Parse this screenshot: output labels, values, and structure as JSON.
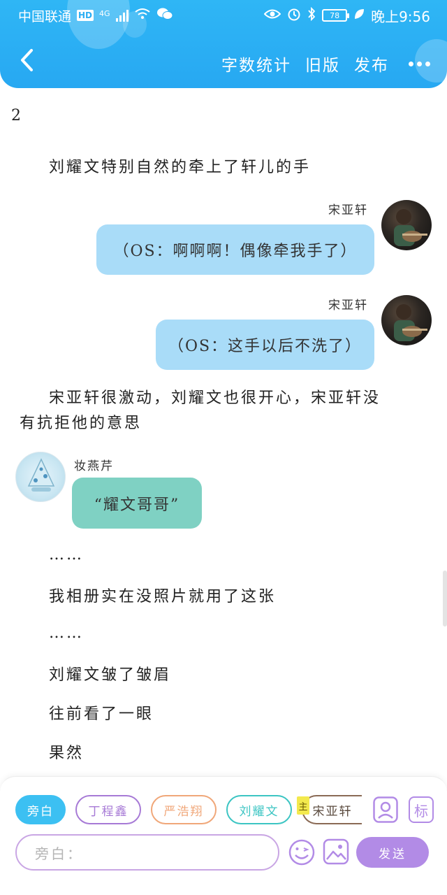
{
  "status_bar": {
    "carrier": "中国联通",
    "network_badge": "HD",
    "network_type": "4G",
    "battery": "78",
    "time": "晚上9:56",
    "icons": [
      "wifi-icon",
      "wechat-icon",
      "eye-icon",
      "alarm-icon",
      "bluetooth-icon",
      "battery-icon",
      "leaf-icon"
    ]
  },
  "nav": {
    "back_icon": "chevron-left-icon",
    "word_count": "字数统计",
    "old_version": "旧版",
    "publish": "发布",
    "more_icon": "more-dots-icon"
  },
  "story": {
    "chapter": "2",
    "narration_1": "刘耀文特别自然的牵上了轩儿的手",
    "msg_1": {
      "name": "宋亚轩",
      "text": "（OS：啊啊啊！偶像牵我手了）"
    },
    "msg_2": {
      "name": "宋亚轩",
      "text": "（OS：这手以后不洗了）"
    },
    "narration_2_line1": "宋亚轩很激动，刘耀文也很开心，宋亚轩没",
    "narration_2_line2": "有抗拒他的意思",
    "msg_3": {
      "name": "妆燕芹",
      "text": "“耀文哥哥”"
    },
    "ellipsis_1": "……",
    "narration_3": "我相册实在没照片就用了这张",
    "ellipsis_2": "……",
    "narration_4": "刘耀文皱了皱眉",
    "narration_5": "往前看了一眼",
    "narration_6": "果然"
  },
  "input_panel": {
    "roles": [
      {
        "label": "旁白",
        "color": "#3cc0f2"
      },
      {
        "label": "丁程鑫",
        "color": "#a77ad6"
      },
      {
        "label": "严浩翔",
        "color": "#f0a779"
      },
      {
        "label": "刘耀文",
        "color": "#3cc5c3"
      },
      {
        "label": "宋亚轩",
        "color": "#8a6a55"
      }
    ],
    "main_tag": "主",
    "placeholder": "旁白：",
    "send": "发送",
    "role_icon": "add-character-icon",
    "tag_icon_label": "标",
    "emoji_icon": "wink-emoji-icon",
    "image_icon": "image-icon"
  }
}
